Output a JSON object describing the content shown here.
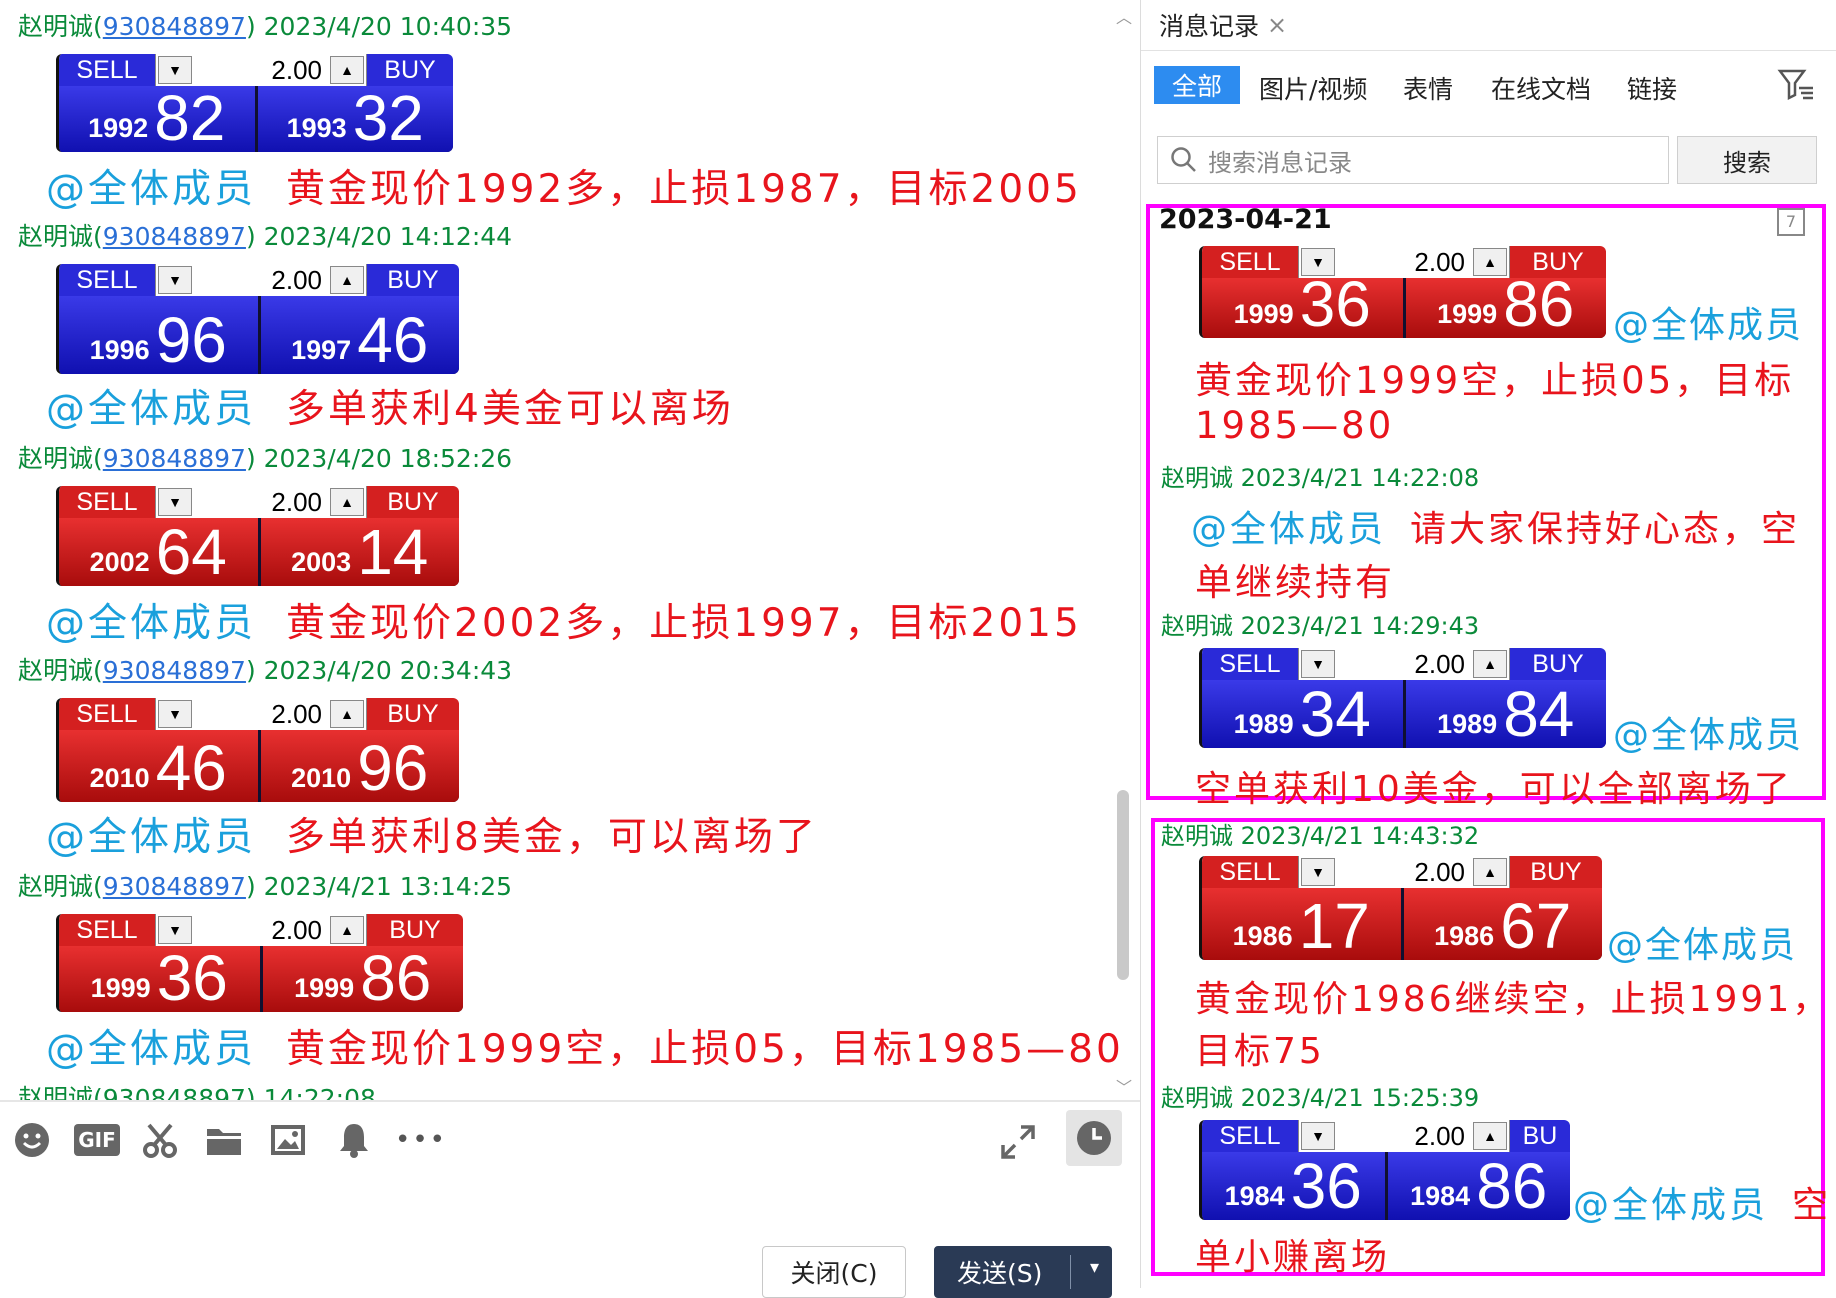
{
  "chat": {
    "messages": [
      {
        "sender": "赵明诚",
        "qq": "930848897",
        "time": "2023/4/20 10:40:35",
        "quote": {
          "color": "blue",
          "sell": "SELL",
          "buy": "BUY",
          "lot": "2.00",
          "bid_small": "1992",
          "bid_big": "82",
          "ask_small": "1993",
          "ask_big": "32"
        },
        "mention": "@全体成员",
        "text": "黄金现价1992多，止损1987，目标2005"
      },
      {
        "sender": "赵明诚",
        "qq": "930848897",
        "time": "2023/4/20 14:12:44",
        "quote": {
          "color": "blue",
          "sell": "SELL",
          "buy": "BUY",
          "lot": "2.00",
          "bid_small": "1996",
          "bid_big": "96",
          "ask_small": "1997",
          "ask_big": "46"
        },
        "mention": "@全体成员",
        "text": "多单获利4美金可以离场"
      },
      {
        "sender": "赵明诚",
        "qq": "930848897",
        "time": "2023/4/20 18:52:26",
        "quote": {
          "color": "red",
          "sell": "SELL",
          "buy": "BUY",
          "lot": "2.00",
          "bid_small": "2002",
          "bid_big": "64",
          "ask_small": "2003",
          "ask_big": "14"
        },
        "mention": "@全体成员",
        "text": "黄金现价2002多，止损1997，目标2015"
      },
      {
        "sender": "赵明诚",
        "qq": "930848897",
        "time": "2023/4/20 20:34:43",
        "quote": {
          "color": "red",
          "sell": "SELL",
          "buy": "BUY",
          "lot": "2.00",
          "bid_small": "2010",
          "bid_big": "46",
          "ask_small": "2010",
          "ask_big": "96"
        },
        "mention": "@全体成员",
        "text": "多单获利8美金，可以离场了"
      },
      {
        "sender": "赵明诚",
        "qq": "930848897",
        "time": "2023/4/21 13:14:25",
        "quote": {
          "color": "red",
          "sell": "SELL",
          "buy": "BUY",
          "lot": "2.00",
          "bid_small": "1999",
          "bid_big": "36",
          "ask_small": "1999",
          "ask_big": "86"
        },
        "mention": "@全体成员",
        "text": "黄金现价1999空，止损05，目标1985—80"
      }
    ],
    "cut_meta": "赵明诚(930848897) 14:22:08"
  },
  "toolbar": {
    "icons": [
      "emoji-icon",
      "gif-icon",
      "scissors-icon",
      "folder-icon",
      "image-icon",
      "bell-icon",
      "more-icon"
    ],
    "gif_label": "GIF",
    "more_label": "•••",
    "close_label": "关闭(C)",
    "send_label": "发送(S)"
  },
  "history": {
    "title": "消息记录",
    "close_glyph": "×",
    "tabs": [
      "全部",
      "图片/视频",
      "表情",
      "在线文档",
      "链接"
    ],
    "search_placeholder": "搜索消息记录",
    "search_button": "搜索",
    "date": "2023-04-21",
    "calendar_day": "7",
    "q1": {
      "color": "red",
      "sell": "SELL",
      "buy": "BUY",
      "lot": "2.00",
      "bid_small": "1999",
      "bid_big": "36",
      "ask_small": "1999",
      "ask_big": "86"
    },
    "m1_mention": "@全体成员",
    "m1_text_a": "黄金现价1999空，止损05，目标",
    "m1_text_b": "1985—80",
    "m2_meta": "赵明诚 2023/4/21 14:22:08",
    "m2_mention": "@全体成员",
    "m2_text_a": "请大家保持好心态，空",
    "m2_text_b": "单继续持有",
    "m3_meta": "赵明诚 2023/4/21 14:29:43",
    "q3": {
      "color": "blue",
      "sell": "SELL",
      "buy": "BUY",
      "lot": "2.00",
      "bid_small": "1989",
      "bid_big": "34",
      "ask_small": "1989",
      "ask_big": "84"
    },
    "m3_mention": "@全体成员",
    "m3_text": "空单获利10美金，可以全部离场了",
    "m4_meta": "赵明诚 2023/4/21 14:43:32",
    "q4": {
      "color": "red",
      "sell": "SELL",
      "buy": "BUY",
      "lot": "2.00",
      "bid_small": "1986",
      "bid_big": "17",
      "ask_small": "1986",
      "ask_big": "67"
    },
    "m4_mention": "@全体成员",
    "m4_text_a": "黄金现价1986继续空，止损1991，",
    "m4_text_b": "目标75",
    "m5_meta": "赵明诚 2023/4/21 15:25:39",
    "q5": {
      "color": "blue",
      "sell": "SELL",
      "buy": "BU",
      "lot": "2.00",
      "bid_small": "1984",
      "bid_big": "36",
      "ask_small": "1984",
      "ask_big": "86"
    },
    "m5_mention": "@全体成员",
    "m5_text_a": "空",
    "m5_text_b": "单小赚离场"
  },
  "colors": {
    "highlight": "#ff00ff",
    "tab_active": "#2d8cf0",
    "sender": "#0a8a3a",
    "mention": "#1aa0dc",
    "message": "#e8141c"
  }
}
